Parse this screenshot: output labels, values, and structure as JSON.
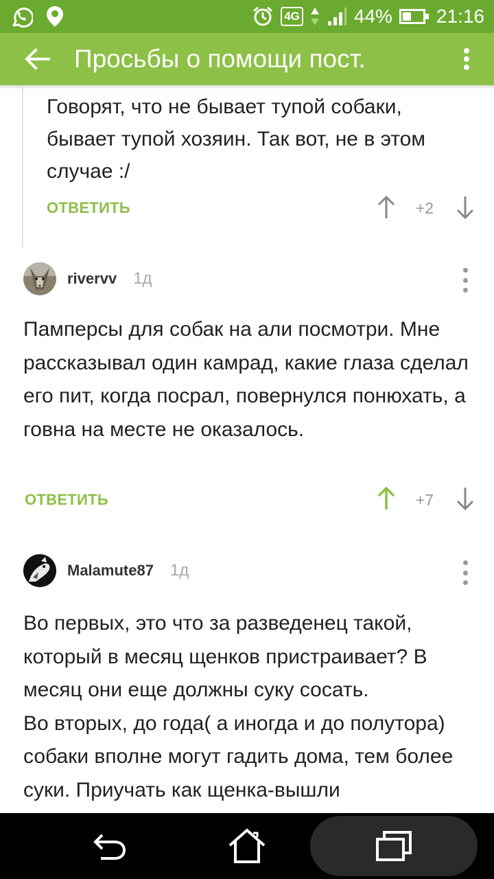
{
  "status_bar": {
    "battery_percent": "44%",
    "battery_level": 0.44,
    "time": "21:16",
    "network": "4G",
    "icons": [
      "viber-icon",
      "location-pin-icon",
      "alarm-icon",
      "signal-icon",
      "battery-icon"
    ]
  },
  "app_bar": {
    "title": "Просьбы о помощи пост.",
    "back_icon": "back-arrow-icon",
    "menu_icon": "more-vertical-icon"
  },
  "colors": {
    "status_bar": "#6aaa2f",
    "app_bar": "#8dc046",
    "accent": "#8dc046",
    "text": "#222222",
    "muted": "#999999"
  },
  "comments": [
    {
      "nested": true,
      "text": "Говорят, что не бывает тупой собаки, бывает тупой хозяин. Так вот, не в этом случае :/",
      "reply_label": "ОТВЕТИТЬ",
      "score": "+2",
      "upvoted": false
    },
    {
      "username": "rivervv",
      "time": "1д",
      "text": "Памперсы для собак на али посмотри. Мне рассказывал один камрад, какие глаза сделал его пит, когда посрал, повернулся понюхать, а говна на месте не оказалось.",
      "reply_label": "ОТВЕТИТЬ",
      "score": "+7",
      "upvoted": true
    },
    {
      "username": "Malamute87",
      "time": "1д",
      "text": "Во первых, это что за разведенец такой, который в месяц щенков пристраивает? В месяц они еще должны суку сосать.\nВо вторых, до года( а иногда и до полутора) собаки вполне могут гадить дома, тем более суки. Приучать как щенка-вышли"
    }
  ],
  "nav_bar": {
    "icons": [
      "back-nav-icon",
      "home-icon",
      "recent-apps-icon"
    ]
  }
}
